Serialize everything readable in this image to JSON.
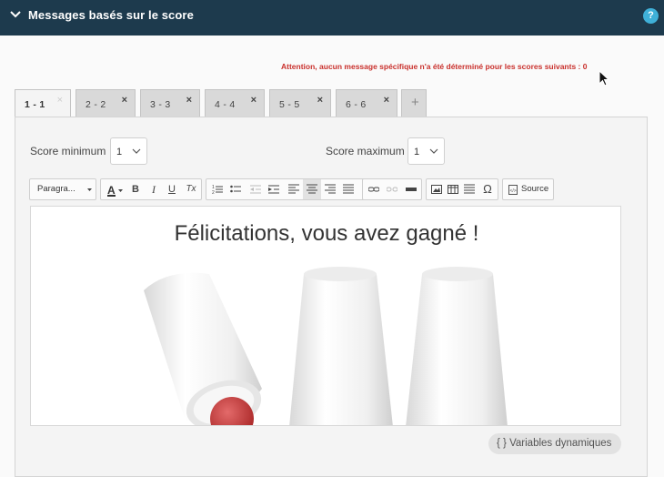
{
  "header": {
    "title": "Messages basés sur le score",
    "help_label": "?"
  },
  "warning": "Attention, aucun message spécifique n'a été déterminé pour les scores suivants : 0",
  "tabs": [
    {
      "label": "1 - 1",
      "close": "×"
    },
    {
      "label": "2 - 2",
      "close": "×"
    },
    {
      "label": "3 - 3",
      "close": "×"
    },
    {
      "label": "4 - 4",
      "close": "×"
    },
    {
      "label": "5 - 5",
      "close": "×"
    },
    {
      "label": "6 - 6",
      "close": "×"
    }
  ],
  "add_tab_label": "+",
  "score_min": {
    "label": "Score minimum",
    "value": "1"
  },
  "score_max": {
    "label": "Score maximum",
    "value": "1"
  },
  "toolbar": {
    "format_label": "Paragra...",
    "bold": "B",
    "italic": "I",
    "underline": "U",
    "clear_format": "Tx",
    "omega": "Ω",
    "source_label": "Source"
  },
  "editor": {
    "heading": "Félicitations, vous avez gagné !"
  },
  "variables_button": "{ } Variables dynamiques",
  "colors": {
    "header_bg": "#1d3a4d",
    "warning": "#c9302c",
    "help": "#3fb0d8"
  }
}
